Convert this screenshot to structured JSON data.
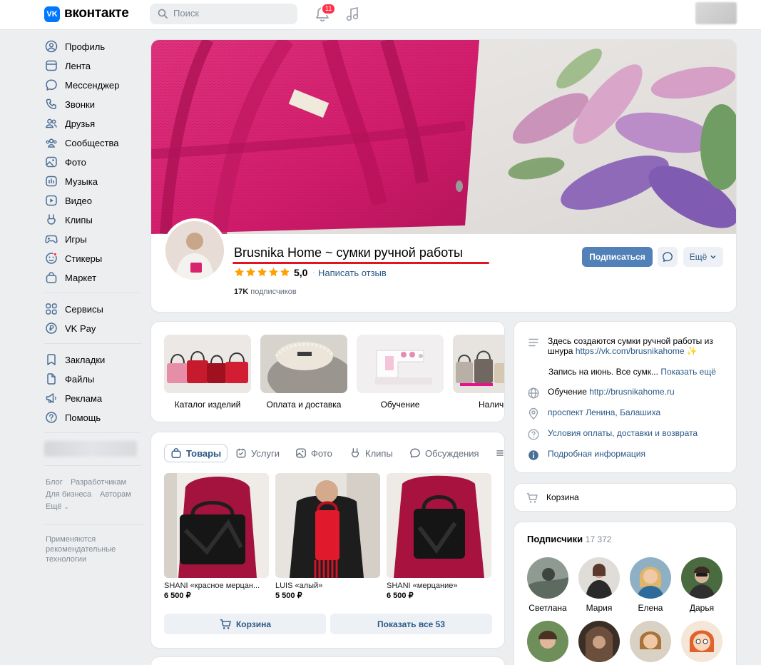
{
  "header": {
    "logo_text": "вконтакте",
    "logo_mark": "VK",
    "search_placeholder": "Поиск",
    "notifications_count": "11"
  },
  "sidebar": {
    "items": [
      {
        "label": "Профиль",
        "icon": "user-circle-icon"
      },
      {
        "label": "Лента",
        "icon": "newsfeed-icon"
      },
      {
        "label": "Мессенджер",
        "icon": "message-icon"
      },
      {
        "label": "Звонки",
        "icon": "phone-icon"
      },
      {
        "label": "Друзья",
        "icon": "friends-icon"
      },
      {
        "label": "Сообщества",
        "icon": "communities-icon"
      },
      {
        "label": "Фото",
        "icon": "photo-icon"
      },
      {
        "label": "Музыка",
        "icon": "music-icon"
      },
      {
        "label": "Видео",
        "icon": "video-icon"
      },
      {
        "label": "Клипы",
        "icon": "clips-icon"
      },
      {
        "label": "Игры",
        "icon": "gamepad-icon"
      },
      {
        "label": "Стикеры",
        "icon": "sticker-icon"
      },
      {
        "label": "Маркет",
        "icon": "market-icon"
      },
      {
        "label": "Сервисы",
        "icon": "services-icon"
      },
      {
        "label": "VK Pay",
        "icon": "vkpay-icon"
      },
      {
        "label": "Закладки",
        "icon": "bookmark-icon"
      },
      {
        "label": "Файлы",
        "icon": "file-icon"
      },
      {
        "label": "Реклама",
        "icon": "megaphone-icon"
      },
      {
        "label": "Помощь",
        "icon": "help-icon"
      }
    ],
    "footer_links": [
      "Блог",
      "Разработчикам",
      "Для бизнеса",
      "Авторам",
      "Ещё"
    ],
    "recommendation_note": "Применяются рекомендательные технологии"
  },
  "profile": {
    "name": "Brusnika Home ~ сумки ручной работы",
    "rating": "5,0",
    "review_link": "Написать отзыв",
    "subscribers_count": "17K",
    "subscribers_label": "подписчиков",
    "subscribe_button": "Подписаться",
    "more_button": "Ещё"
  },
  "categories": [
    {
      "label": "Каталог изделий"
    },
    {
      "label": "Оплата и доставка"
    },
    {
      "label": "Обучение"
    },
    {
      "label": "Налич"
    }
  ],
  "tabs": [
    {
      "label": "Товары",
      "icon": "bag-icon"
    },
    {
      "label": "Услуги",
      "icon": "services-check-icon"
    },
    {
      "label": "Фото",
      "icon": "photo-icon"
    },
    {
      "label": "Клипы",
      "icon": "clips-icon"
    },
    {
      "label": "Обсуждения",
      "icon": "discussion-icon"
    }
  ],
  "products": [
    {
      "name": "SHANI «красное мерцан...",
      "price": "6 500 ₽"
    },
    {
      "name": "LUIS «алый»",
      "price": "5 500 ₽"
    },
    {
      "name": "SHANI «мерцание»",
      "price": "6 500 ₽"
    }
  ],
  "product_buttons": {
    "cart": "Корзина",
    "show_all": "Показать все 53"
  },
  "info": {
    "description": "Здесь создаются сумки ручной работы из шнура",
    "description_link": "https://vk.com/brusnikahome",
    "description_emoji": "✨",
    "schedule": "Запись на июнь. Все сумк...",
    "show_more": "Показать ещё",
    "training_label": "Обучение",
    "training_link": "http://brusnikahome.ru",
    "address": "проспект Ленина, Балашиха",
    "terms": "Условия оплаты, доставки и возврата",
    "details": "Подробная информация"
  },
  "cart": {
    "label": "Корзина"
  },
  "subscribers": {
    "title": "Подписчики",
    "count": "17 372",
    "members": [
      {
        "name": "Светлана"
      },
      {
        "name": "Мария"
      },
      {
        "name": "Елена"
      },
      {
        "name": "Дарья"
      }
    ]
  },
  "colors": {
    "accent": "#5181b8",
    "link": "#2a5885",
    "background": "#edeef0",
    "logo": "#0077ff",
    "underline": "#e3141e"
  }
}
